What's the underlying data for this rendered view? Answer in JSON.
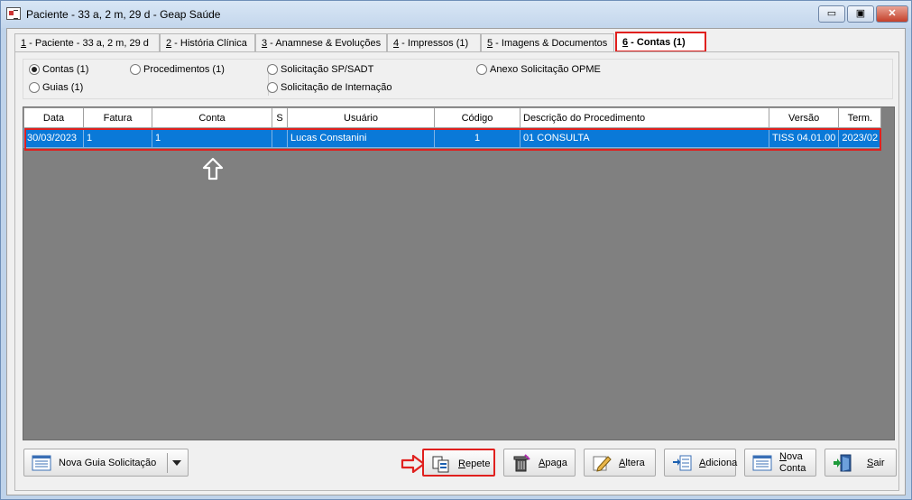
{
  "window": {
    "title": "Paciente - 33 a, 2 m, 29 d - Geap Saúde",
    "controls": {
      "minimize": "▭",
      "maximize": "▣",
      "close": "✕"
    }
  },
  "tabs": [
    {
      "hotkey": "1",
      "label": " - Paciente - 33 a, 2 m, 29 d"
    },
    {
      "hotkey": "2",
      "label": " - História Clínica"
    },
    {
      "hotkey": "3",
      "label": " - Anamnese & Evoluções"
    },
    {
      "hotkey": "4",
      "label": " - Impressos  (1)"
    },
    {
      "hotkey": "5",
      "label": " - Imagens & Documentos"
    },
    {
      "hotkey": "6",
      "label": " - Contas  (1)"
    }
  ],
  "radios": {
    "contas": "Contas (1)",
    "guias": "Guias (1)",
    "procedimentos": "Procedimentos (1)",
    "solicitacao_sp_sadt": "Solicitação SP/SADT",
    "solicitacao_internacao": "Solicitação de Internação",
    "anexo_opme": "Anexo Solicitação OPME"
  },
  "table": {
    "headers": [
      "Data",
      "Fatura",
      "Conta",
      "S",
      "Usuário",
      "Código",
      "Descrição do Procedimento",
      "Versão",
      "Term."
    ],
    "rows": [
      [
        "30/03/2023",
        "1",
        "1",
        "",
        "Lucas Constanini",
        "1",
        "01 CONSULTA",
        "TISS 04.01.00",
        "2023/02"
      ]
    ]
  },
  "buttons": {
    "nova_guia": "Nova Guia Solicitação",
    "repete_hotkey": "R",
    "repete_rest": "epete",
    "apaga_hotkey": "A",
    "apaga_rest": "paga",
    "altera_hotkey": "A",
    "altera_rest": "ltera",
    "adiciona_hotkey": "A",
    "adiciona_rest": "diciona",
    "nova_conta_hotkey": "N",
    "nova_conta_rest": "ova",
    "nova_conta_line2": "Conta",
    "sair_hotkey": "S",
    "sair_rest": "air"
  },
  "colors": {
    "selection": "#0a79d8",
    "highlight_red": "#e0201e",
    "grid_background": "#808080"
  }
}
